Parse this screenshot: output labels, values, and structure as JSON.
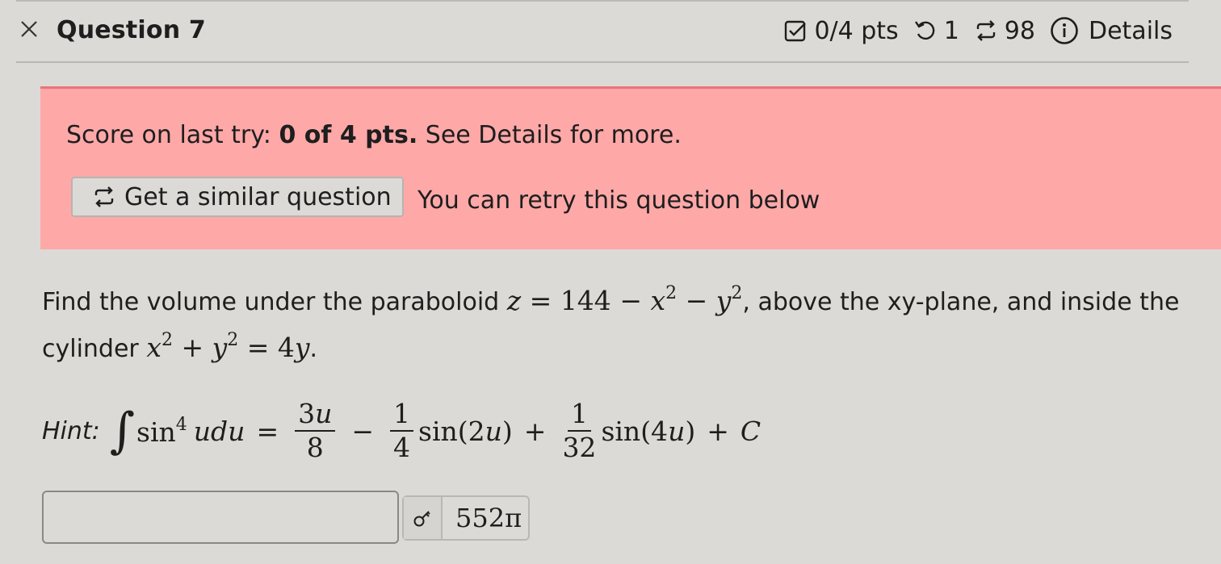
{
  "header": {
    "title": "Question 7",
    "points": "0/4 pts",
    "attempts": "1",
    "retries": "98",
    "details_label": "Details"
  },
  "alert": {
    "score_prefix": "Score on last try: ",
    "score_value": "0 of 4 pts.",
    "score_suffix": " See Details for more.",
    "similar_button": "Get a similar question",
    "retry_text": "You can retry this question below",
    "bg_color": "#ffa8a8",
    "border_color": "#e9737a"
  },
  "question": {
    "text_1": "Find the volume under the paraboloid ",
    "text_2": ", above the xy-plane, and inside the",
    "text_3": "cylinder ",
    "text_4": "."
  },
  "hint": {
    "label": "Hint:"
  },
  "answer": {
    "value": "",
    "preview": "552π"
  },
  "icons": {
    "close": "close-icon",
    "points": "checkbox-icon",
    "attempts": "undo-icon",
    "retries": "repeat-icon",
    "details": "info-icon",
    "preview": "key-icon"
  }
}
